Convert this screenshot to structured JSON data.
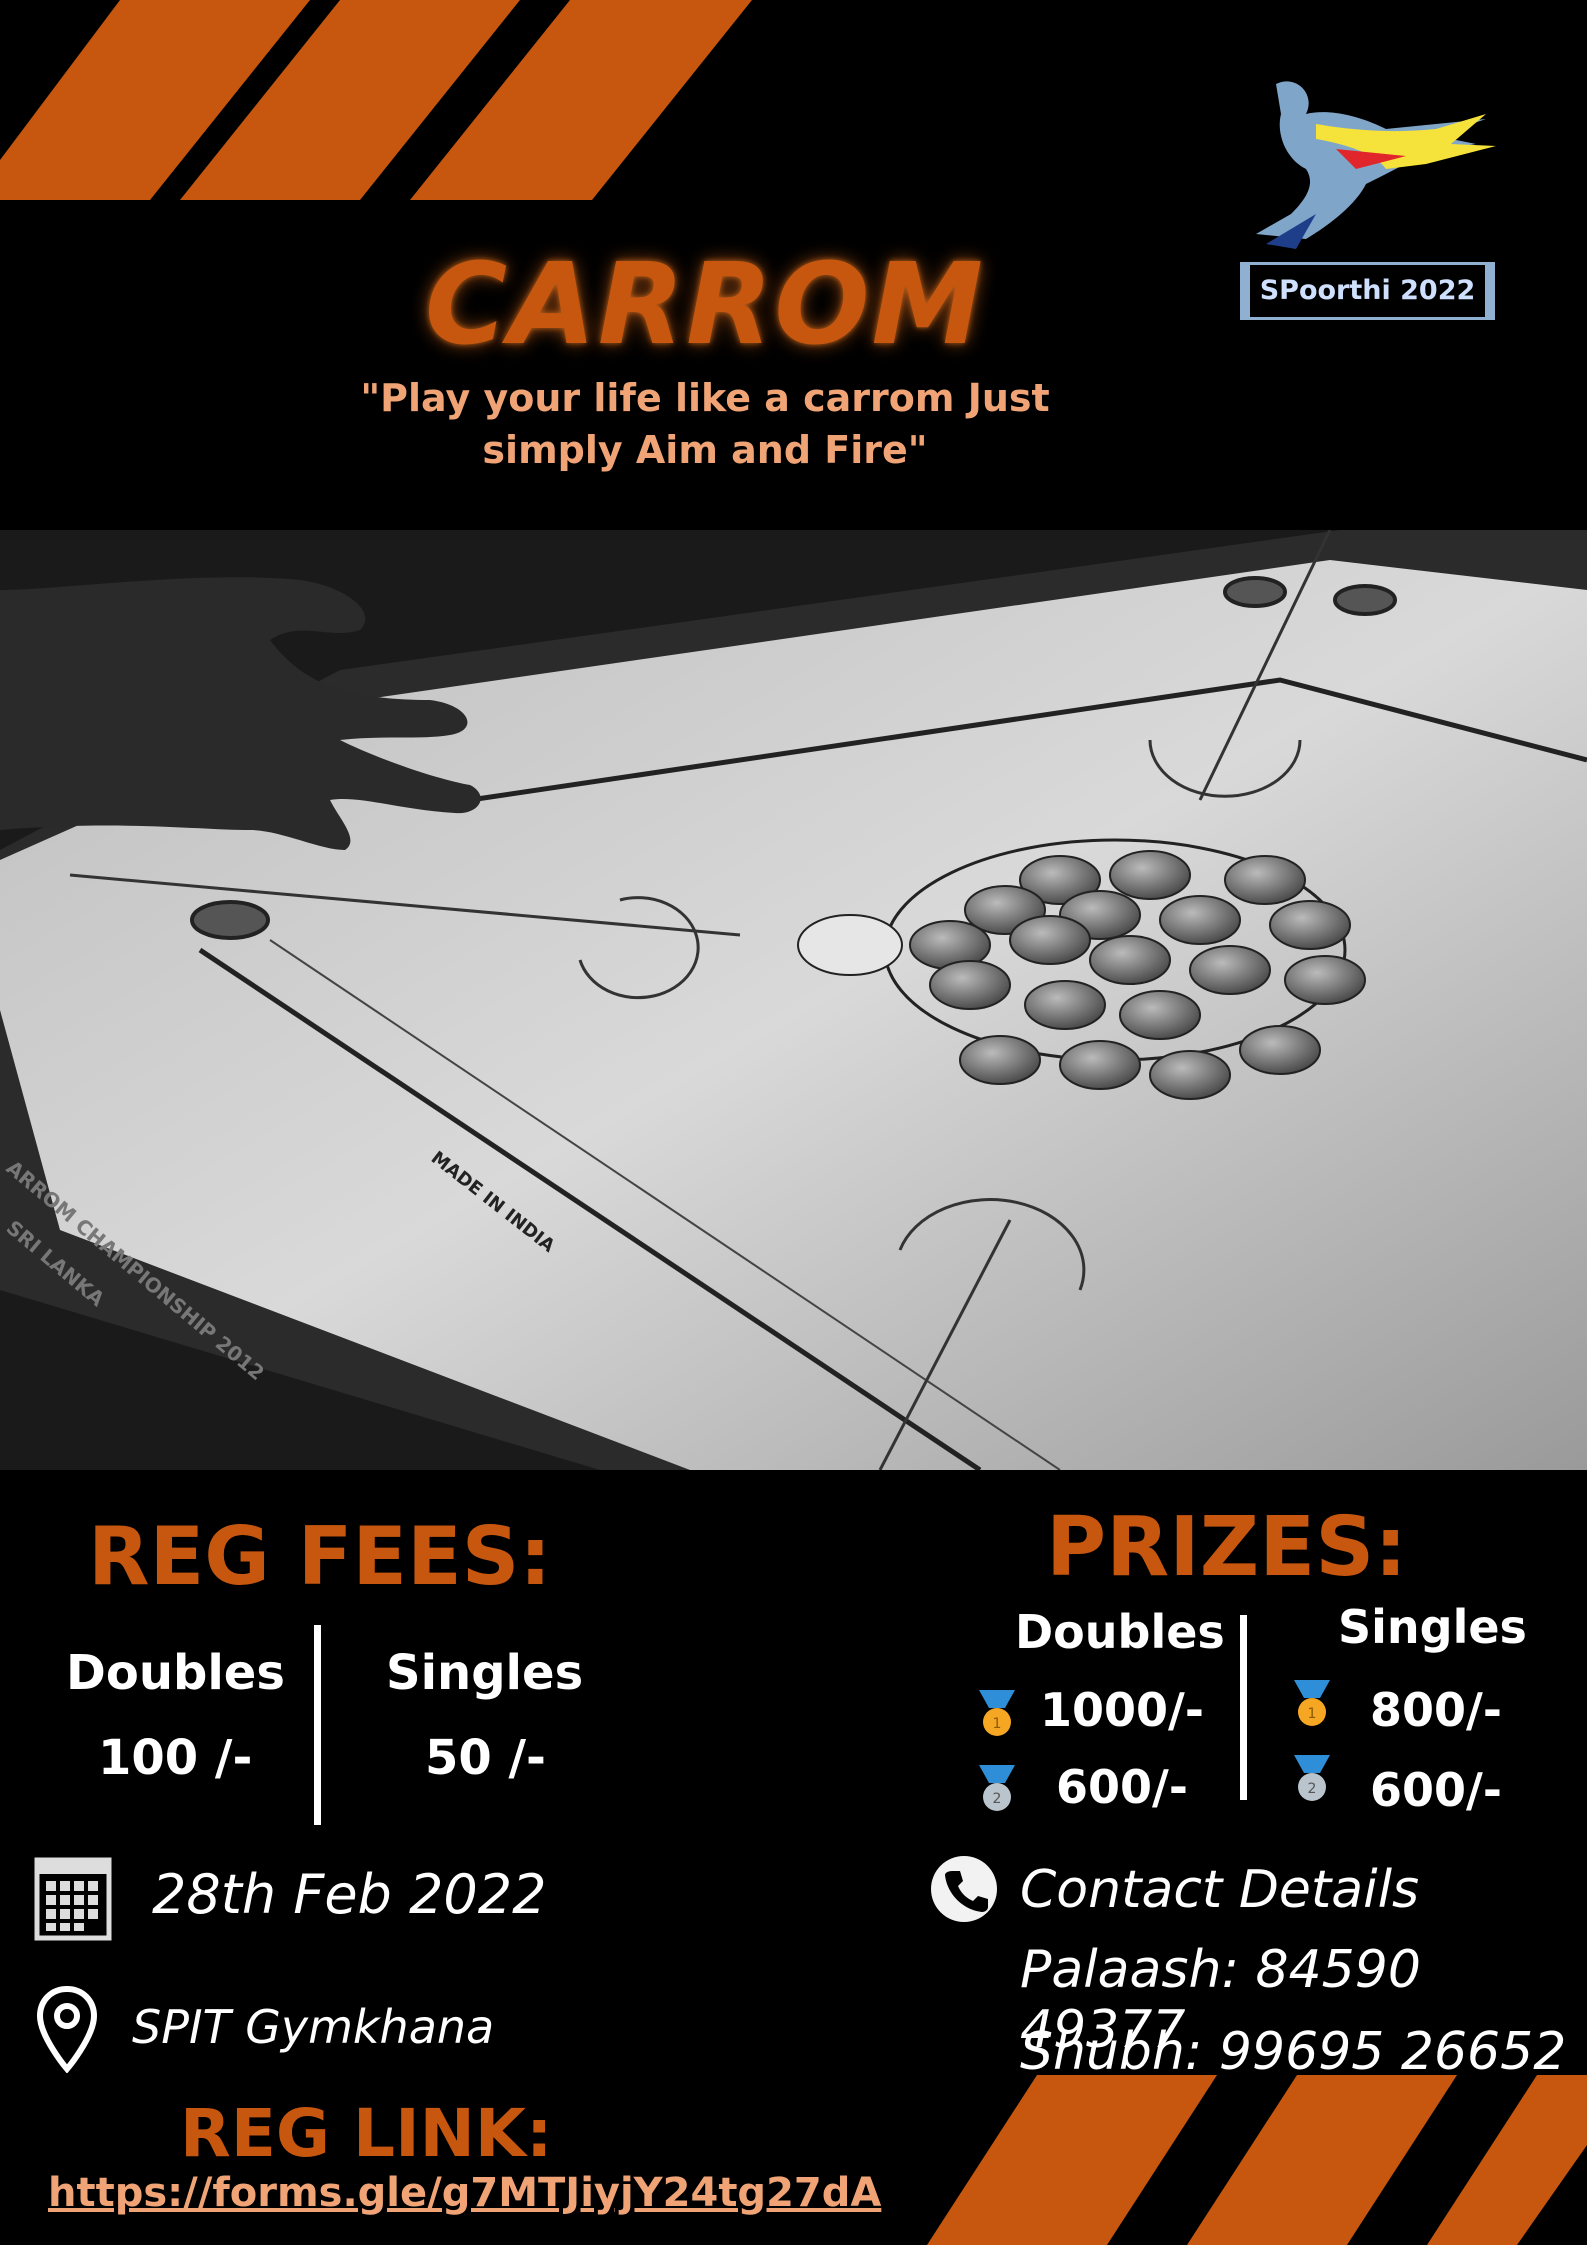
{
  "title": "CARROM",
  "tagline_line1": "\"Play your life like a carrom Just",
  "tagline_line2": "simply Aim and Fire\"",
  "logo": {
    "text": "SPoorthi 2022",
    "icon": "runner-logo-icon"
  },
  "photo_text": {
    "board_mark": "MADE IN INDIA",
    "side_mark_1": "ARROM CHAMPIONSHIP 2012",
    "side_mark_2": "SRI LANKA"
  },
  "reg_fees": {
    "heading": "REG FEES:",
    "doubles_label": "Doubles",
    "doubles_fee": "100 /-",
    "singles_label": "Singles",
    "singles_fee": "50 /-"
  },
  "prizes": {
    "heading": "PRIZES:",
    "doubles_label": "Doubles",
    "singles_label": "Singles",
    "doubles_first": "1000/-",
    "doubles_second": "600/-",
    "singles_first": "800/-",
    "singles_second": "600/-",
    "gold_color": "#f5a623",
    "silver_color": "#b9c4cc",
    "ribbon_color": "#2e8fd8"
  },
  "event": {
    "date": "28th Feb 2022",
    "venue": "SPIT Gymkhana"
  },
  "contact": {
    "heading": "Contact Details",
    "person1": "Palaash: 84590 49377",
    "person2": "Shubh: 99695 26652"
  },
  "registration": {
    "heading": "REG LINK:",
    "url": "https://forms.gle/g7MTJiyjY24tg27dA"
  },
  "colors": {
    "accent": "#c7560f",
    "tagline": "#f0a476",
    "background": "#000000"
  }
}
